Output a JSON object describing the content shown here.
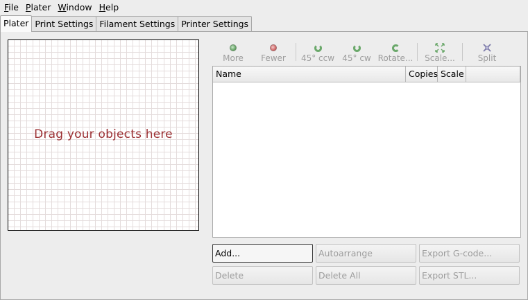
{
  "menubar": {
    "items": [
      {
        "mnemonic": "F",
        "rest": "ile"
      },
      {
        "mnemonic": "P",
        "rest": "later"
      },
      {
        "mnemonic": "W",
        "rest": "indow"
      },
      {
        "mnemonic": "H",
        "rest": "elp"
      }
    ]
  },
  "tabs": {
    "items": [
      {
        "label": "Plater",
        "active": true
      },
      {
        "label": "Print Settings",
        "active": false
      },
      {
        "label": "Filament Settings",
        "active": false
      },
      {
        "label": "Printer Settings",
        "active": false
      }
    ]
  },
  "bed": {
    "hint": "Drag your objects here"
  },
  "toolbar": {
    "more": "More",
    "fewer": "Fewer",
    "rotate_ccw": "45° ccw",
    "rotate_cw": "45° cw",
    "rotate": "Rotate...",
    "scale": "Scale...",
    "split": "Split"
  },
  "object_list": {
    "columns": [
      "Name",
      "Copies",
      "Scale"
    ]
  },
  "buttons": {
    "add": "Add...",
    "autoarrange": "Autoarrange",
    "export_gcode": "Export G-code...",
    "delete": "Delete",
    "delete_all": "Delete All",
    "export_stl": "Export STL..."
  },
  "colors": {
    "hint_text": "#9c3033",
    "disabled_text": "#9d9d9d",
    "grid_line": "#e4dcdc"
  }
}
